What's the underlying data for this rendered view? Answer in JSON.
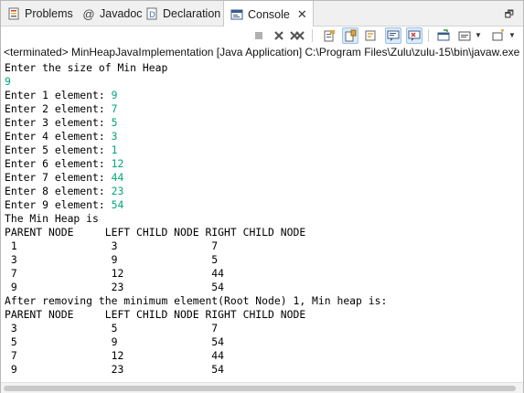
{
  "tabs": [
    {
      "label": "Problems",
      "icon": "problems-icon",
      "active": false
    },
    {
      "label": "Javadoc",
      "icon": "javadoc-icon",
      "active": false
    },
    {
      "label": "Declaration",
      "icon": "declaration-icon",
      "active": false
    },
    {
      "label": "Console",
      "icon": "console-icon",
      "active": true
    }
  ],
  "tab_close": "✕",
  "restore_icon": "🗗",
  "status": "<terminated> MinHeapJavaImplementation [Java Application] C:\\Program Files\\Zulu\\zulu-15\\bin\\javaw.exe",
  "input_color": "#00a67d",
  "console": {
    "prompt_size": "Enter the size of Min Heap",
    "size_value": "9",
    "elements": [
      {
        "label": "Enter 1 element: ",
        "value": "9"
      },
      {
        "label": "Enter 2 element: ",
        "value": "7"
      },
      {
        "label": "Enter 3 element: ",
        "value": "5"
      },
      {
        "label": "Enter 4 element: ",
        "value": "3"
      },
      {
        "label": "Enter 5 element: ",
        "value": "1"
      },
      {
        "label": "Enter 6 element: ",
        "value": "12"
      },
      {
        "label": "Enter 7 element: ",
        "value": "44"
      },
      {
        "label": "Enter 8 element: ",
        "value": "23"
      },
      {
        "label": "Enter 9 element: ",
        "value": "54"
      }
    ],
    "heap_title": "The Min Heap is",
    "header": "PARENT NODE     LEFT CHILD NODE RIGHT CHILD NODE",
    "heap_rows": [
      " 1               3               7",
      " 3               9               5",
      " 7               12              44",
      " 9               23              54"
    ],
    "after_title": "After removing the minimum element(Root Node) 1, Min heap is:",
    "header2": "PARENT NODE     LEFT CHILD NODE RIGHT CHILD NODE",
    "after_rows": [
      " 3               5               7",
      " 5               9               54",
      " 7               12              44",
      " 9               23              54"
    ]
  }
}
